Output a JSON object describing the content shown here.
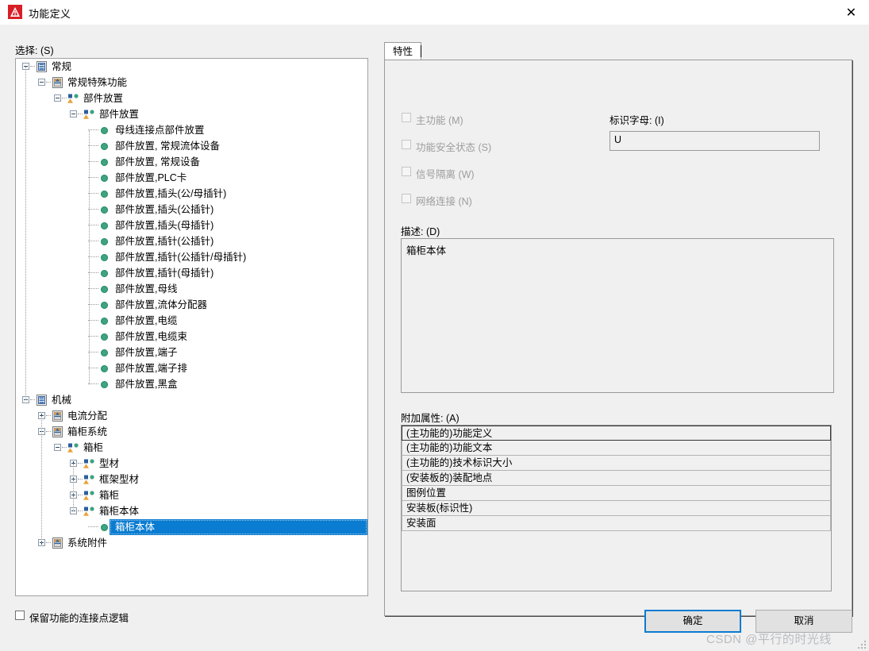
{
  "window": {
    "title": "功能定义",
    "icon": "eplan-warning-icon",
    "close_label": "✕"
  },
  "left": {
    "select_label": "选择: (S)",
    "tree": [
      {
        "depth": 0,
        "toggle": "minus",
        "icon": "general-node-icon",
        "label": "常规"
      },
      {
        "depth": 1,
        "toggle": "minus",
        "icon": "special-function-icon",
        "label": "常规特殊功能"
      },
      {
        "depth": 2,
        "toggle": "minus",
        "icon": "part-placement-icon",
        "label": "部件放置"
      },
      {
        "depth": 3,
        "toggle": "minus",
        "icon": "part-placement-icon",
        "label": "部件放置"
      },
      {
        "depth": 4,
        "toggle": "none",
        "icon": "green-dot-icon",
        "label": "母线连接点部件放置"
      },
      {
        "depth": 4,
        "toggle": "none",
        "icon": "green-dot-icon",
        "label": "部件放置, 常规流体设备"
      },
      {
        "depth": 4,
        "toggle": "none",
        "icon": "green-dot-icon",
        "label": "部件放置, 常规设备"
      },
      {
        "depth": 4,
        "toggle": "none",
        "icon": "green-dot-icon",
        "label": "部件放置,PLC卡"
      },
      {
        "depth": 4,
        "toggle": "none",
        "icon": "green-dot-icon",
        "label": "部件放置,插头(公/母插针)"
      },
      {
        "depth": 4,
        "toggle": "none",
        "icon": "green-dot-icon",
        "label": "部件放置,插头(公插针)"
      },
      {
        "depth": 4,
        "toggle": "none",
        "icon": "green-dot-icon",
        "label": "部件放置,插头(母插针)"
      },
      {
        "depth": 4,
        "toggle": "none",
        "icon": "green-dot-icon",
        "label": "部件放置,插针(公插针)"
      },
      {
        "depth": 4,
        "toggle": "none",
        "icon": "green-dot-icon",
        "label": "部件放置,插针(公插针/母插针)"
      },
      {
        "depth": 4,
        "toggle": "none",
        "icon": "green-dot-icon",
        "label": "部件放置,插针(母插针)"
      },
      {
        "depth": 4,
        "toggle": "none",
        "icon": "green-dot-icon",
        "label": "部件放置,母线"
      },
      {
        "depth": 4,
        "toggle": "none",
        "icon": "green-dot-icon",
        "label": "部件放置,流体分配器"
      },
      {
        "depth": 4,
        "toggle": "none",
        "icon": "green-dot-icon",
        "label": "部件放置,电缆"
      },
      {
        "depth": 4,
        "toggle": "none",
        "icon": "green-dot-icon",
        "label": "部件放置,电缆束"
      },
      {
        "depth": 4,
        "toggle": "none",
        "icon": "green-dot-icon",
        "label": "部件放置,端子"
      },
      {
        "depth": 4,
        "toggle": "none",
        "icon": "green-dot-icon",
        "label": "部件放置,端子排"
      },
      {
        "depth": 4,
        "toggle": "none",
        "icon": "green-dot-icon",
        "label": "部件放置,黑盒"
      },
      {
        "depth": 0,
        "toggle": "minus",
        "icon": "general-node-icon",
        "label": "机械"
      },
      {
        "depth": 1,
        "toggle": "plus",
        "icon": "special-function-icon",
        "label": "电流分配"
      },
      {
        "depth": 1,
        "toggle": "minus",
        "icon": "special-function-icon",
        "label": "箱柜系统"
      },
      {
        "depth": 2,
        "toggle": "minus",
        "icon": "part-placement-icon",
        "label": "箱柜"
      },
      {
        "depth": 3,
        "toggle": "plus",
        "icon": "part-placement-icon",
        "label": "型材"
      },
      {
        "depth": 3,
        "toggle": "plus",
        "icon": "part-placement-icon",
        "label": "框架型材"
      },
      {
        "depth": 3,
        "toggle": "plus",
        "icon": "part-placement-icon",
        "label": "箱柜"
      },
      {
        "depth": 3,
        "toggle": "minus",
        "icon": "part-placement-icon",
        "label": "箱柜本体"
      },
      {
        "depth": 4,
        "toggle": "none",
        "icon": "green-dot-icon",
        "label": "箱柜本体",
        "selected": true
      },
      {
        "depth": 1,
        "toggle": "plus",
        "icon": "special-function-icon",
        "label": "系统附件"
      }
    ]
  },
  "right": {
    "tab_label": "特性",
    "checkboxes": [
      {
        "label": "主功能 (M)",
        "checked": false,
        "disabled": true
      },
      {
        "label": "功能安全状态 (S)",
        "checked": false,
        "disabled": true
      },
      {
        "label": "信号隔离 (W)",
        "checked": false,
        "disabled": true
      },
      {
        "label": "网络连接 (N)",
        "checked": false,
        "disabled": true
      }
    ],
    "ident_letter_label": "标识字母: (I)",
    "ident_letter_value": "U",
    "description_label": "描述: (D)",
    "description_value": "箱柜本体",
    "extra_props_label": "附加属性: (A)",
    "extra_props": [
      "(主功能的)功能定义",
      "(主功能的)功能文本",
      "(主功能的)技术标识大小",
      "(安装板的)装配地点",
      "图例位置",
      "安装板(标识性)",
      "安装面"
    ]
  },
  "footer": {
    "keep_logic_label": "保留功能的连接点逻辑",
    "keep_logic_checked": false,
    "ok_label": "确定",
    "cancel_label": "取消"
  },
  "watermark": "CSDN @平行的时光线",
  "colors": {
    "accent": "#0a7cd1",
    "leaf_green": "#3ea37f",
    "window_bg": "#f0f0f0",
    "icon_red": "#d81f26"
  }
}
